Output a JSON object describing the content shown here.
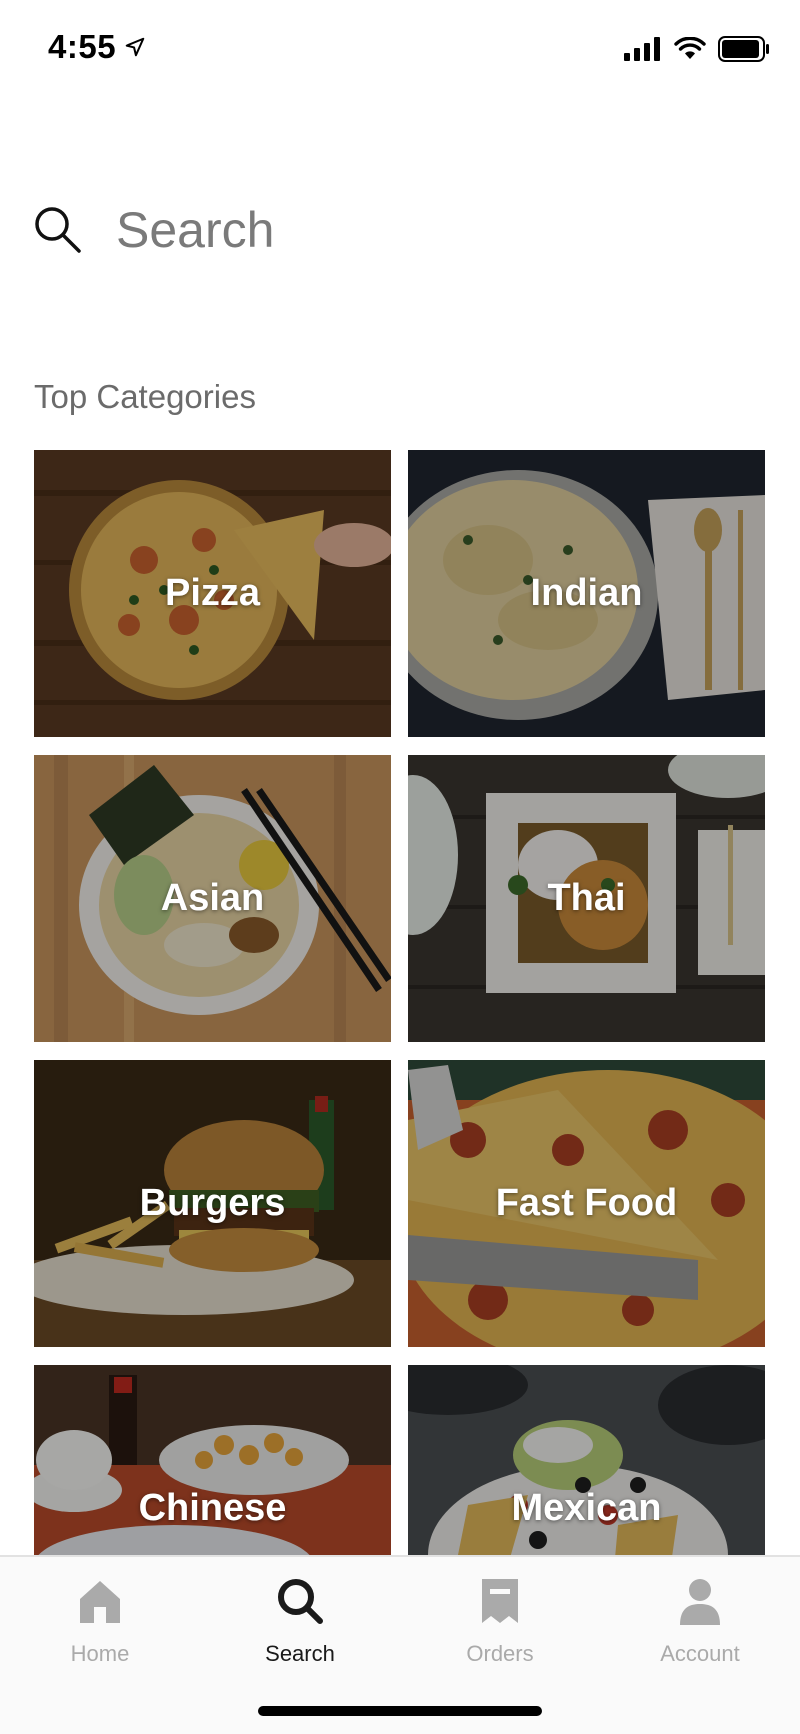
{
  "status_bar": {
    "time": "4:55"
  },
  "search": {
    "placeholder": "Search"
  },
  "section_title": "Top Categories",
  "categories": [
    {
      "label": "Pizza"
    },
    {
      "label": "Indian"
    },
    {
      "label": "Asian"
    },
    {
      "label": "Thai"
    },
    {
      "label": "Burgers"
    },
    {
      "label": "Fast Food"
    },
    {
      "label": "Chinese"
    },
    {
      "label": "Mexican"
    }
  ],
  "nav": {
    "items": [
      {
        "label": "Home",
        "icon": "home-icon",
        "active": false
      },
      {
        "label": "Search",
        "icon": "search-icon",
        "active": true
      },
      {
        "label": "Orders",
        "icon": "receipt-icon",
        "active": false
      },
      {
        "label": "Account",
        "icon": "person-icon",
        "active": false
      }
    ]
  },
  "colors": {
    "inactive_nav": "#aaaaaa",
    "active_nav": "#1a1a1a",
    "placeholder": "#7a7a7a"
  }
}
